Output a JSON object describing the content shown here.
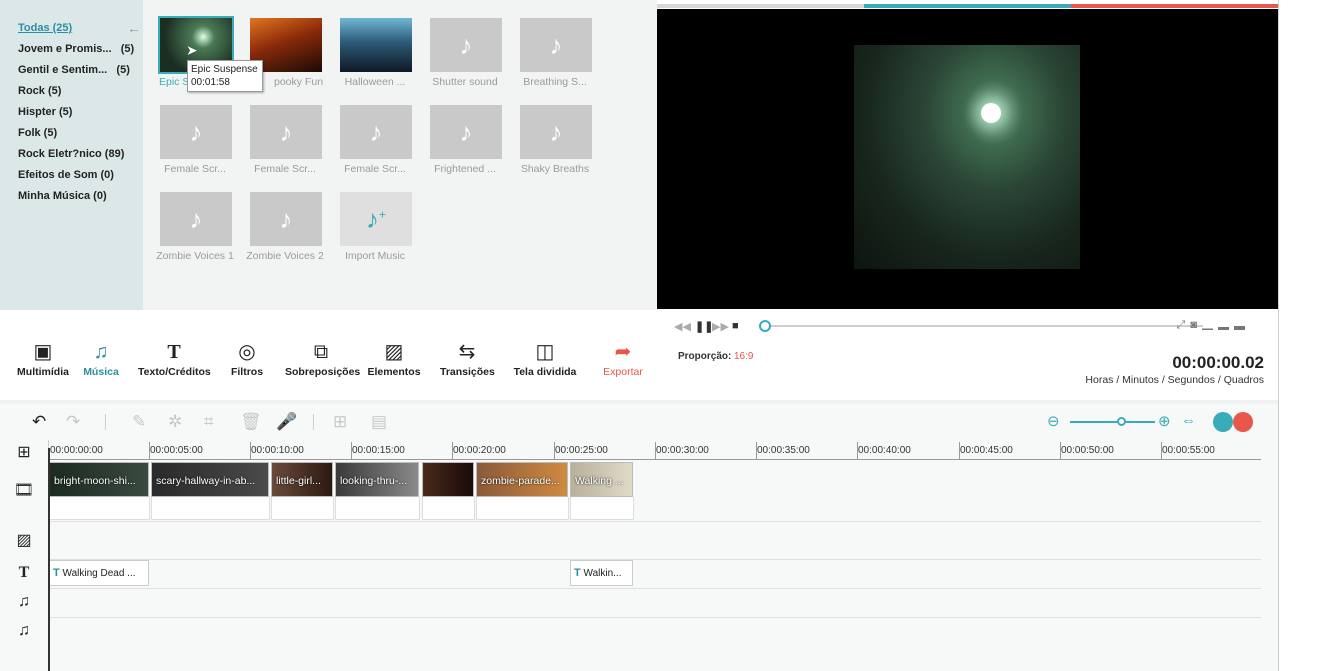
{
  "categories": [
    {
      "label": "Todas (25)",
      "active": true
    },
    {
      "label": "Jovem e Promis...",
      "count": "(5)"
    },
    {
      "label": "Gentil e Sentim...",
      "count": "(5)"
    },
    {
      "label": "Rock (5)"
    },
    {
      "label": "Hispter (5)"
    },
    {
      "label": "Folk (5)"
    },
    {
      "label": "Rock Eletr?nico (89)"
    },
    {
      "label": "Efeitos de Som (0)"
    },
    {
      "label": "Minha Música (0)"
    }
  ],
  "media": [
    {
      "label": "Epic Suspense",
      "shown": "Epic S",
      "type": "image",
      "selected": true
    },
    {
      "label": "Spooky Fun",
      "shown": "pooky Fun",
      "type": "image"
    },
    {
      "label": "Halloween ...",
      "type": "image"
    },
    {
      "label": "Shutter sound",
      "type": "audio"
    },
    {
      "label": "Breathing S...",
      "type": "audio"
    },
    {
      "label": "Female Scr...",
      "type": "audio"
    },
    {
      "label": "Female Scr...",
      "type": "audio"
    },
    {
      "label": "Female Scr...",
      "type": "audio"
    },
    {
      "label": "Frightened ...",
      "type": "audio"
    },
    {
      "label": "Shaky Breaths",
      "type": "audio"
    },
    {
      "label": "Zombie Voices 1",
      "type": "audio"
    },
    {
      "label": "Zombie Voices 2",
      "type": "audio"
    },
    {
      "label": "Import Music",
      "type": "import"
    }
  ],
  "tooltip": {
    "title": "Epic Suspense",
    "duration": "00:01:58"
  },
  "toolbar": [
    {
      "label": "Multimídia",
      "icon": "media-icon"
    },
    {
      "label": "Música",
      "icon": "music-icon",
      "active": true
    },
    {
      "label": "Texto/Créditos",
      "icon": "text-icon"
    },
    {
      "label": "Filtros",
      "icon": "filter-icon"
    },
    {
      "label": "Sobreposições",
      "icon": "overlay-icon"
    },
    {
      "label": "Elementos",
      "icon": "elements-icon"
    },
    {
      "label": "Transições",
      "icon": "transitions-icon"
    },
    {
      "label": "Tela dividida",
      "icon": "split-screen-icon"
    },
    {
      "label": "Exportar",
      "icon": "export-icon"
    }
  ],
  "playback": {
    "ratio_label": "Proporção:",
    "ratio_value": "16:9",
    "timecode": "00:00:00.02",
    "timecode_caption": "Horas / Minutos / Segundos / Quadros",
    "progress": 0.005
  },
  "ruler": [
    "00:00:00:00",
    "00:00:05:00",
    "00:00:10:00",
    "00:00:15:00",
    "00:00:20:00",
    "00:00:25:00",
    "00:00:30:00",
    "00:00:35:00",
    "00:00:40:00",
    "00:00:45:00",
    "00:00:50:00",
    "00:00:55:00"
  ],
  "video_clips": [
    {
      "label": "bright-moon-shi..."
    },
    {
      "label": "scary-hallway-in-ab..."
    },
    {
      "label": "little-girl..."
    },
    {
      "label": "looking-thru-..."
    },
    {
      "label": ""
    },
    {
      "label": "zombie-parade..."
    },
    {
      "label": "Walking ..."
    }
  ],
  "text_clips": [
    {
      "label": "Walking Dead ..."
    },
    {
      "label": "Walkin..."
    }
  ],
  "colors": {
    "accent": "#3aabb8",
    "export": "#e8574a",
    "panel": "#dce8e8"
  }
}
